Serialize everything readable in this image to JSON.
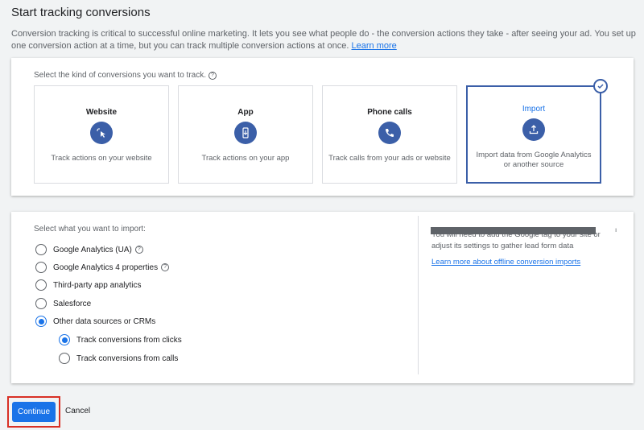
{
  "header": {
    "title": "Start tracking conversions",
    "intro": "Conversion tracking is critical to successful online marketing. It lets you see what people do - the conversion actions they take - after seeing your ad. You set up one conversion action at a time, but you can track multiple conversion actions at once.",
    "learn_more": "Learn more"
  },
  "kinds": {
    "prompt": "Select the kind of conversions you want to track.",
    "tiles": [
      {
        "title": "Website",
        "desc": "Track actions on your website",
        "icon": "cursor-click-icon",
        "selected": false
      },
      {
        "title": "App",
        "desc": "Track actions on your app",
        "icon": "mobile-download-icon",
        "selected": false
      },
      {
        "title": "Phone calls",
        "desc": "Track calls from your ads or website",
        "icon": "phone-icon",
        "selected": false
      },
      {
        "title": "Import",
        "desc": "Import data from Google Analytics or another source",
        "icon": "upload-icon",
        "selected": true
      }
    ]
  },
  "import": {
    "prompt": "Select what you want to import:",
    "options": [
      {
        "label": "Google Analytics (UA)",
        "checked": false,
        "help": true
      },
      {
        "label": "Google Analytics 4 properties",
        "checked": false,
        "help": true
      },
      {
        "label": "Third-party app analytics",
        "checked": false
      },
      {
        "label": "Salesforce",
        "checked": false
      },
      {
        "label": "Other data sources or CRMs",
        "checked": true
      }
    ],
    "sub_options": [
      {
        "label": "Track conversions from clicks",
        "checked": true
      },
      {
        "label": "Track conversions from calls",
        "checked": false
      }
    ],
    "side_text": "You will need to add the Google tag to your site or adjust its settings to gather lead form data",
    "side_link": "Learn more about offline conversion imports"
  },
  "footer": {
    "continue_label": "Continue",
    "cancel_label": "Cancel"
  },
  "colors": {
    "accent": "#1a73e8",
    "icon_bg": "#3b5fa8",
    "highlight_box": "#d93025"
  }
}
